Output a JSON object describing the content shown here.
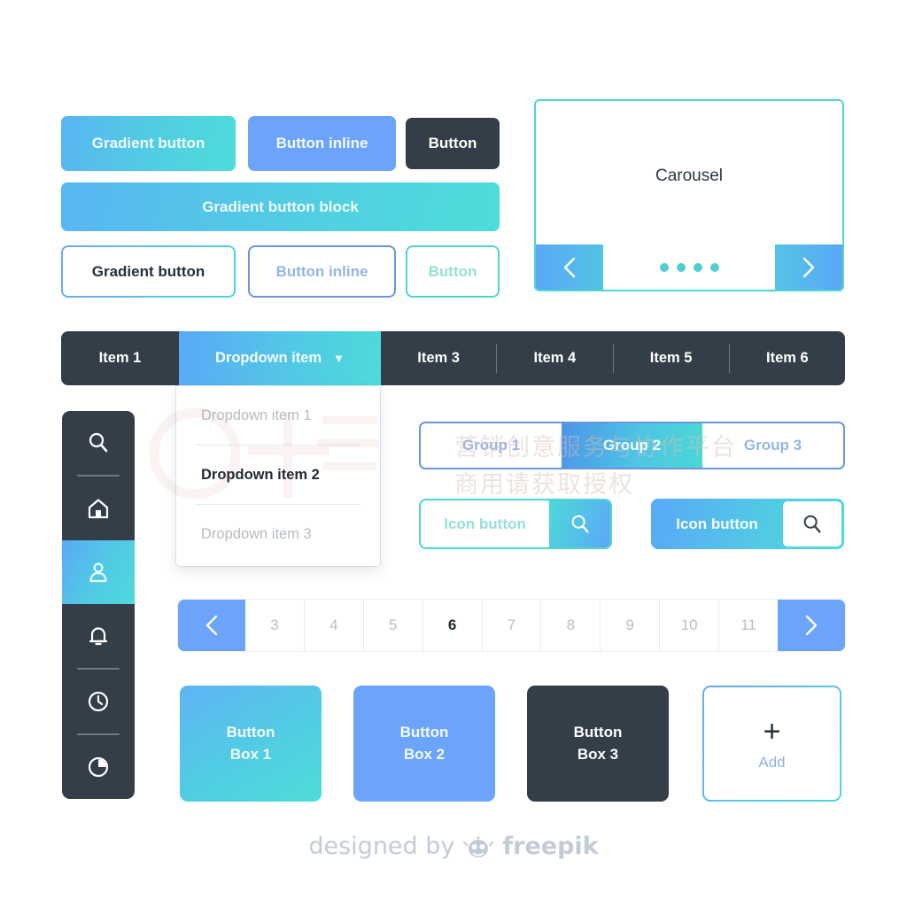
{
  "buttons_row1": [
    {
      "label": "Gradient button",
      "style": "gradient"
    },
    {
      "label": "Button inline",
      "style": "blue"
    },
    {
      "label": "Button",
      "style": "dark"
    }
  ],
  "button_block": {
    "label": "Gradient button block"
  },
  "buttons_outline": [
    {
      "label": "Gradient button",
      "style": "gradient-border"
    },
    {
      "label": "Button inline",
      "style": "blue-border"
    },
    {
      "label": "Button",
      "style": "teal-border"
    }
  ],
  "carousel": {
    "label": "Carousel",
    "prev_icon": "chevron-left-icon",
    "next_icon": "chevron-right-icon",
    "dots": 4,
    "active_dot": 0
  },
  "navbar": {
    "items": [
      {
        "label": "Item 1",
        "active": false
      },
      {
        "label": "Dropdown item",
        "active": true,
        "caret": "▼"
      },
      {
        "label": "Item 3",
        "active": false
      },
      {
        "label": "Item 4",
        "active": false
      },
      {
        "label": "Item 5",
        "active": false
      },
      {
        "label": "Item 6",
        "active": false
      }
    ]
  },
  "dropdown": {
    "items": [
      {
        "label": "Dropdown item 1",
        "active": false
      },
      {
        "label": "Dropdown item 2",
        "active": true
      },
      {
        "label": "Dropdown item 3",
        "active": false
      }
    ]
  },
  "sidebar": {
    "items": [
      {
        "icon": "search-icon",
        "active": false
      },
      {
        "icon": "home-icon",
        "active": false
      },
      {
        "icon": "user-icon",
        "active": true
      },
      {
        "icon": "bell-icon",
        "active": false
      },
      {
        "icon": "clock-icon",
        "active": false
      },
      {
        "icon": "pie-chart-icon",
        "active": false
      }
    ]
  },
  "group_buttons": [
    {
      "label": "Group 1",
      "active": false
    },
    {
      "label": "Group 2",
      "active": true
    },
    {
      "label": "Group 3",
      "active": false
    }
  ],
  "icon_buttons": [
    {
      "label": "Icon button",
      "icon": "search-icon",
      "style": "outline"
    },
    {
      "label": "Icon button",
      "icon": "search-icon",
      "style": "filled"
    }
  ],
  "pagination": {
    "prev_icon": "chevron-left-icon",
    "next_icon": "chevron-right-icon",
    "pages": [
      "3",
      "4",
      "5",
      "6",
      "7",
      "8",
      "9",
      "10",
      "11"
    ],
    "active_page": "6"
  },
  "box_buttons": [
    {
      "line1": "Button",
      "line2": "Box 1",
      "style": "gradient"
    },
    {
      "line1": "Button",
      "line2": "Box 2",
      "style": "blue"
    },
    {
      "line1": "Button",
      "line2": "Box 3",
      "style": "dark"
    }
  ],
  "add_box": {
    "plus": "+",
    "label": "Add",
    "icon": "plus-icon"
  },
  "footer": {
    "prefix": "designed by",
    "brand": "freepik",
    "icon": "freepik-logo-icon"
  },
  "watermark": {
    "line1": "营销创意服务与协作平台",
    "line2": "商用请获取授权"
  },
  "colors": {
    "gradient_start": "#5aa9f7",
    "gradient_end": "#4ddbd9",
    "blue": "#6ba4fa",
    "dark": "#333e48",
    "teal_border": "#4fd6cf",
    "blue_border": "#6b95e0",
    "muted_text": "#b9bfc5"
  }
}
